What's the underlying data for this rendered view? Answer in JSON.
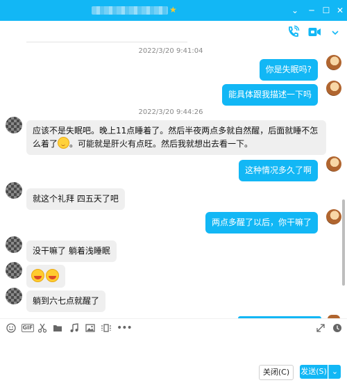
{
  "window": {
    "controls": {
      "dropdown": "⌄",
      "minimize": "─",
      "maximize": "☐",
      "close": "✕"
    }
  },
  "colors": {
    "accent": "#12b7f5",
    "incoming_bubble": "#efefef"
  },
  "header_icons": [
    "phone-icon",
    "video-call-icon",
    "expand-panel-icon"
  ],
  "messages": {
    "ts1": "2022/3/20 9:41:04",
    "m1": "你是失眠吗?",
    "m2": "能具体跟我描述一下吗",
    "ts2": "2022/3/20 9:44:26",
    "m3_part1": "应该不是失眠吧。晚上11点睡着了。然后半夜两点多就自然醒，后面就睡不怎么着了",
    "m3_part2": "。可能就是肝火有点旺。然后我就想出去看一下。",
    "m4": "这种情况多久了啊",
    "m5": "就这个礼拜 四五天了吧",
    "m6": "两点多醒了以后，你干嘛了",
    "m7": "没干嘛了 躺着浅睡眠",
    "m9": "躺到六七点就醒了"
  },
  "input_toolbar": {
    "gif": "GIF",
    "icons": [
      "emoji-icon",
      "gif-icon",
      "scissors-icon",
      "folder-icon",
      "music-icon",
      "image-icon",
      "screen-record-icon",
      "more-icon",
      "fullscreen-icon",
      "history-icon"
    ]
  },
  "buttons": {
    "close": "关闭(C)",
    "send": "发送(S)",
    "send_options": "⌄"
  }
}
